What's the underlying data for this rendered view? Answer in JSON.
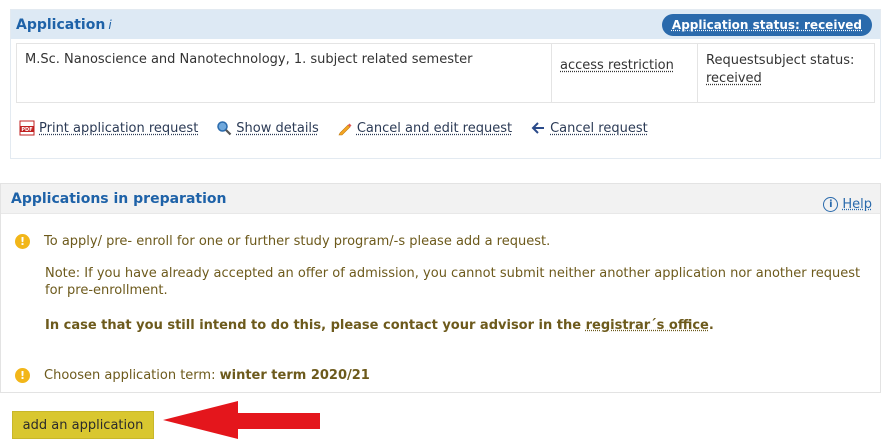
{
  "application": {
    "title": "Application",
    "title_mark": "ⅰ",
    "status_pill": "Application status: received",
    "row": {
      "name": "M.Sc. Nanoscience and Nanotechnology, 1. subject related semester",
      "restriction": "access restriction",
      "status_label": "Requestsubject status:",
      "status_value": "received"
    },
    "actions": [
      {
        "label": "Print application request",
        "icon": "pdf-icon"
      },
      {
        "label": "Show details",
        "icon": "magnifier-icon"
      },
      {
        "label": "Cancel and edit request",
        "icon": "pencil-icon"
      },
      {
        "label": "Cancel request",
        "icon": "arrow-left-icon"
      }
    ]
  },
  "preparation": {
    "title": "Applications in preparation",
    "help": "Help",
    "message": "To apply/ pre- enroll for one or further study program/-s please add a request.",
    "note": "Note: If you have already accepted an offer of admission, you cannot submit neither another application nor another request for pre-enrollment.",
    "contact_prefix": "In case that you still intend to do this, please contact your advisor in the ",
    "contact_link": "registrar´s office",
    "contact_suffix": ".",
    "term_label": "Choosen application term: ",
    "term_value": "winter term 2020/21"
  },
  "add_button": "add an application",
  "colors": {
    "primary": "#2a6aac",
    "header_bg": "#dde9f4",
    "warning": "#f2b619",
    "button": "#d9c730",
    "arrow": "#e4161c"
  }
}
